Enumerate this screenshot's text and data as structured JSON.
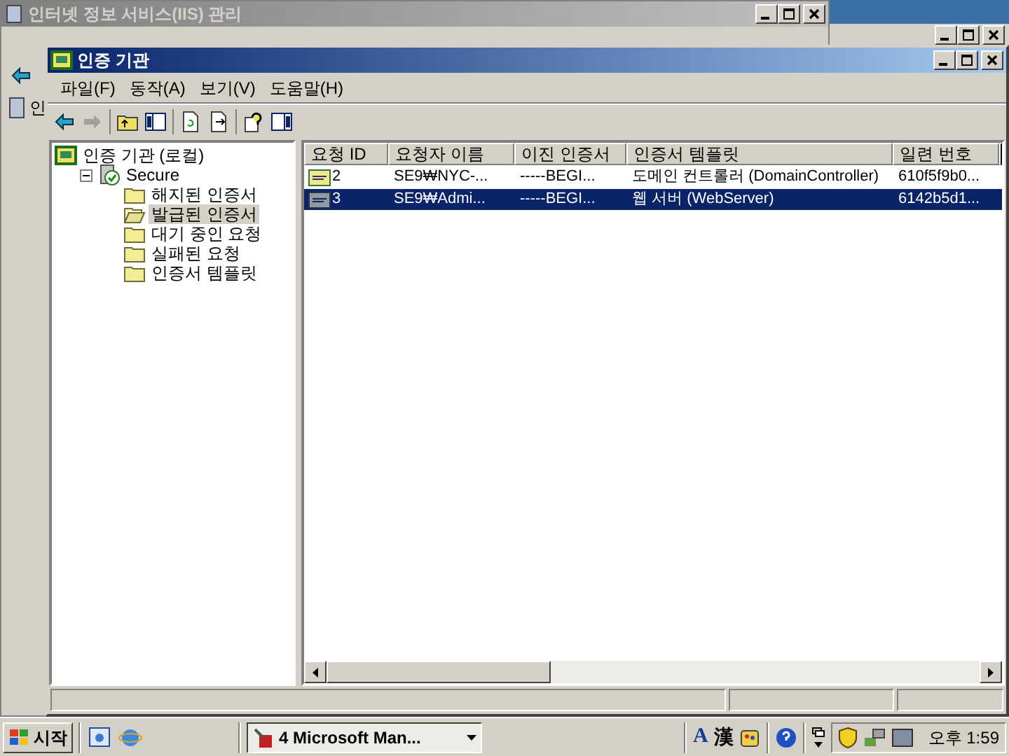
{
  "back_window": {
    "title": "인터넷 정보 서비스(IIS) 관리",
    "tree_label": "인"
  },
  "window": {
    "title": "인증 기관",
    "active": true
  },
  "menu": [
    {
      "label": "파일(F)"
    },
    {
      "label": "동작(A)"
    },
    {
      "label": "보기(V)"
    },
    {
      "label": "도움말(H)"
    }
  ],
  "tree": [
    {
      "label": "인증 기관 (로컬)",
      "kind": "root",
      "selected": false,
      "children": [
        {
          "label": "Secure",
          "kind": "ca",
          "selected": false,
          "expanded": true,
          "children": [
            {
              "label": "해지된 인증서",
              "kind": "folder",
              "selected": false
            },
            {
              "label": "발급된 인증서",
              "kind": "folder",
              "selected": true
            },
            {
              "label": "대기 중인 요청",
              "kind": "folder",
              "selected": false
            },
            {
              "label": "실패된 요청",
              "kind": "folder",
              "selected": false
            },
            {
              "label": "인증서 템플릿",
              "kind": "folder",
              "selected": false
            }
          ]
        }
      ]
    }
  ],
  "list": {
    "columns": [
      "요청 ID",
      "요청자 이름",
      "이진 인증서",
      "인증서 템플릿",
      "일련 번호"
    ],
    "rows": [
      {
        "cells": [
          "2",
          "SE9₩NYC-...",
          "-----BEGI...",
          "도메인 컨트롤러 (DomainController)",
          "610f5f9b0..."
        ],
        "selected": false
      },
      {
        "cells": [
          "3",
          "SE9₩Admi...",
          "-----BEGI...",
          "웹 서버 (WebServer)",
          "6142b5d1..."
        ],
        "selected": true
      }
    ]
  },
  "taskbar": {
    "start": "시작",
    "tasks": [
      {
        "label": "4 Microsoft Man...",
        "selected": true
      }
    ],
    "ime": [
      "A",
      "漢"
    ],
    "clock": "오후 1:59"
  }
}
